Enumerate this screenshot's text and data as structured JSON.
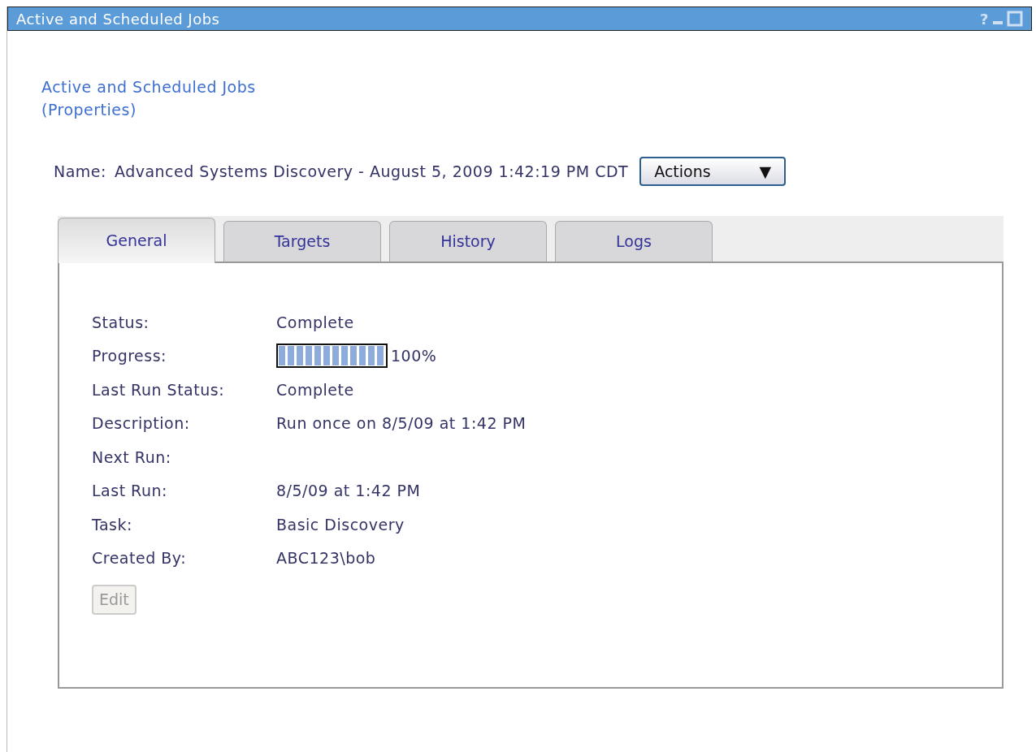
{
  "window": {
    "title": "Active and Scheduled Jobs",
    "help": "?"
  },
  "heading": {
    "title": "Active and Scheduled Jobs",
    "subtitle": "(Properties)"
  },
  "name_row": {
    "label": "Name:",
    "value": "Advanced Systems Discovery - August 5, 2009 1:42:19 PM CDT",
    "actions": {
      "label": "Actions",
      "caret": "▼"
    }
  },
  "tabs": [
    {
      "label": "General",
      "selected": true
    },
    {
      "label": "Targets",
      "selected": false
    },
    {
      "label": "History",
      "selected": false
    },
    {
      "label": "Logs",
      "selected": false
    }
  ],
  "fields": [
    {
      "kind": "text",
      "label": "Status:",
      "value": "Complete"
    },
    {
      "kind": "progress",
      "label": "Progress:",
      "level": 1,
      "reading": "100%"
    },
    {
      "kind": "text",
      "label": "Last Run Status:",
      "value": "Complete"
    },
    {
      "kind": "text",
      "label": "Description:",
      "value": "Run once on 8/5/09 at 1:42 PM"
    },
    {
      "kind": "text",
      "label": "Next Run:"
    },
    {
      "kind": "text",
      "label": "Last Run:",
      "value": "8/5/09 at 1:42 PM"
    },
    {
      "kind": "text",
      "label": "Task:",
      "value": "Basic Discovery"
    },
    {
      "kind": "text",
      "label": "Created By:",
      "value": "ABC123\\bob"
    }
  ],
  "edit_button": {
    "label": "Edit",
    "disabled": true
  }
}
